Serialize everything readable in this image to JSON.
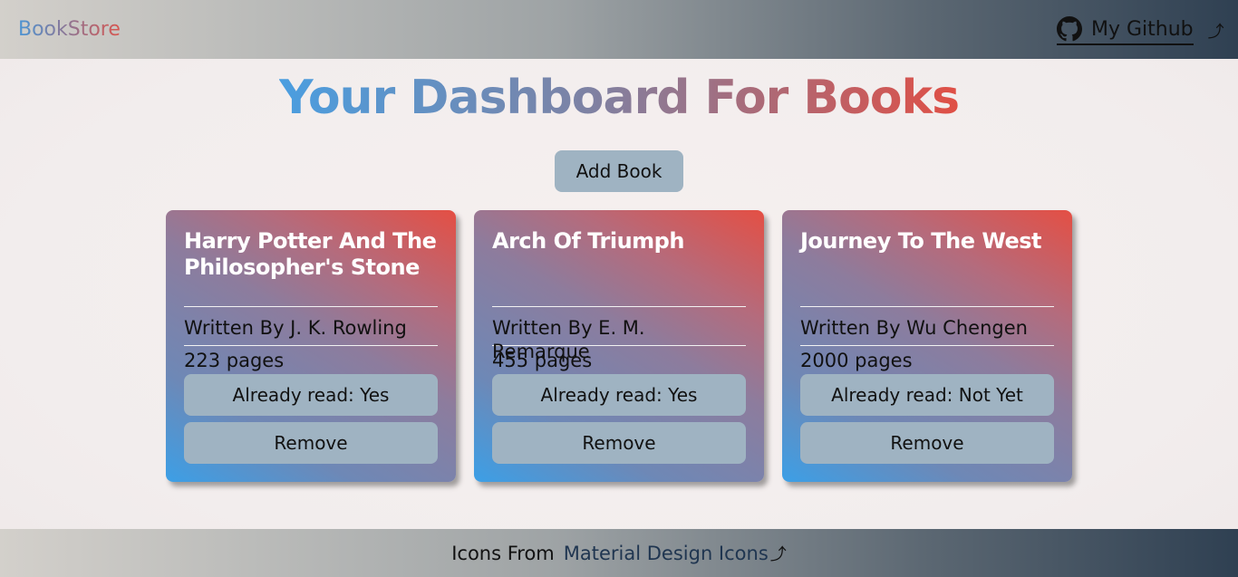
{
  "header": {
    "brand": "BookStore",
    "github_label": "My Github",
    "github_icon": "github-icon",
    "external_icon": "open-in-new-icon"
  },
  "page": {
    "title": "Your Dashboard For Books",
    "add_book_label": "Add Book"
  },
  "books": [
    {
      "title": "Harry Potter And The Philosopher's Stone",
      "author_line": "Written By J. K. Rowling",
      "pages_line": "223 pages",
      "read_label": "Already read: Yes",
      "remove_label": "Remove"
    },
    {
      "title": "Arch Of Triumph",
      "author_line": "Written By E. M. Remarque",
      "pages_line": "455 pages",
      "read_label": "Already read: Yes",
      "remove_label": "Remove"
    },
    {
      "title": "Journey To The West",
      "author_line": "Written By Wu Chengen",
      "pages_line": "2000 pages",
      "read_label": "Already read: Not Yet",
      "remove_label": "Remove"
    }
  ],
  "footer": {
    "credit_text": "Icons From",
    "credit_link": "Material Design Icons"
  },
  "colors": {
    "button_bg": "#9fb3c2",
    "accent_blue": "#4a9ee0",
    "accent_red": "#e04f45"
  }
}
